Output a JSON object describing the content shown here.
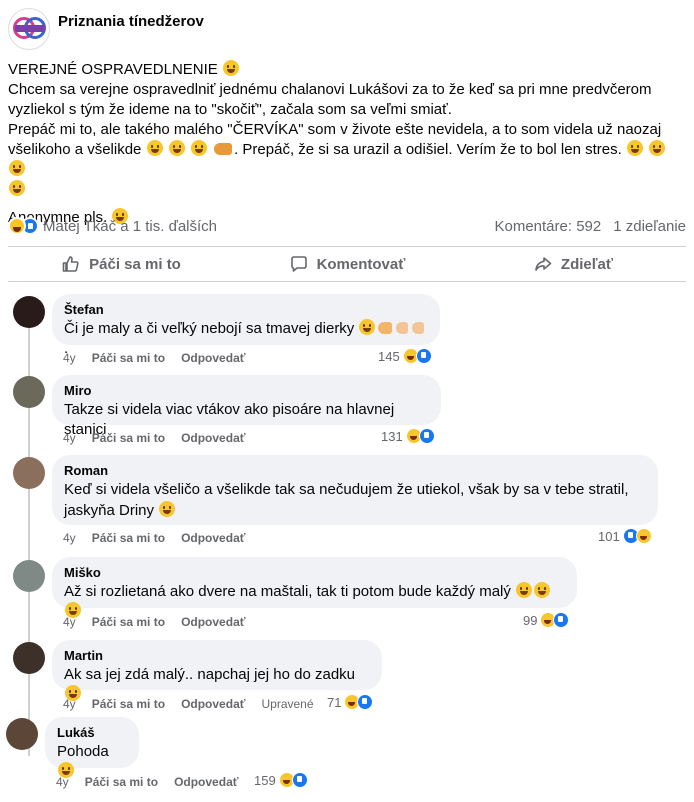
{
  "post": {
    "page_name": "Priznania tínedžerov",
    "text_line_1": "VEREJNÉ OSPRAVEDLNENIE",
    "text_line_2": "Chcem sa verejne ospravedlniť jednému chalanovi Lukášovi za to že keď sa pri mne predvčerom",
    "text_line_3": "vyzliekol s tým že ideme na to \"skočiť\", začala som sa veľmi smiať.",
    "text_line_4": "Prepáč mi to, ale takého malého \"ČERVÍKA\" som v živote ešte nevidela, a to som videla už naozaj",
    "text_line_5a": "všelikoho a všelikde",
    "text_line_5b": ". Prepáč, že si sa urazil a odišiel. Verím že to bol len stres.",
    "text_line_6": "Anonymne  pls."
  },
  "stats": {
    "reactors": "Matej Tkáč a 1 tis. ďalších",
    "comments": "Komentáre: 592",
    "shares": "1 zdieľanie"
  },
  "actions": {
    "like": "Páči sa mi to",
    "comment": "Komentovať",
    "share": "Zdieľať"
  },
  "comments": [
    {
      "name": "Štefan",
      "text": "Či je maly a či veľký nebojí sa tmavej dierky",
      "text_suffix": ".",
      "age": "4y",
      "like": "Páči sa mi to",
      "reply": "Odpovedať",
      "count": "145",
      "avatar_color": "#2a1b1b"
    },
    {
      "name": "Miro",
      "text": "Takze si videla viac vtákov ako pisoáre na hlavnej stanici",
      "age": "4y",
      "like": "Páči sa mi to",
      "reply": "Odpovedať",
      "count": "131",
      "avatar_color": "#6b6a5a"
    },
    {
      "name": "Roman",
      "text_1": "Keď si videla všeličo a všelikde tak sa nečudujem že utiekol, však by sa v tebe stratil,",
      "text_2": "jaskyňa Driny",
      "age": "4y",
      "like": "Páči sa mi to",
      "reply": "Odpovedať",
      "count": "101",
      "avatar_color": "#8a6f5c"
    },
    {
      "name": "Miško",
      "text": "Až si rozlietaná ako dvere na maštali, tak ti potom bude každý malý",
      "age": "4y",
      "like": "Páči sa mi to",
      "reply": "Odpovedať",
      "count": "99",
      "avatar_color": "#7f8a86"
    },
    {
      "name": "Martin",
      "text": "Ak sa jej zdá malý.. napchaj jej ho do zadku",
      "age": "4y",
      "like": "Páči sa mi to",
      "reply": "Odpovedať",
      "edited": "Upravené",
      "count": "71",
      "avatar_color": "#3c3028"
    },
    {
      "name": "Lukáš",
      "text": "Pohoda",
      "age": "4y",
      "like": "Páči sa mi to",
      "reply": "Odpovedať",
      "count": "159",
      "avatar_color": "#5b4638"
    }
  ],
  "colors": {
    "brand_blue": "#1877f2",
    "bubble_bg": "#f0f2f5",
    "secondary_text": "#65676b"
  }
}
